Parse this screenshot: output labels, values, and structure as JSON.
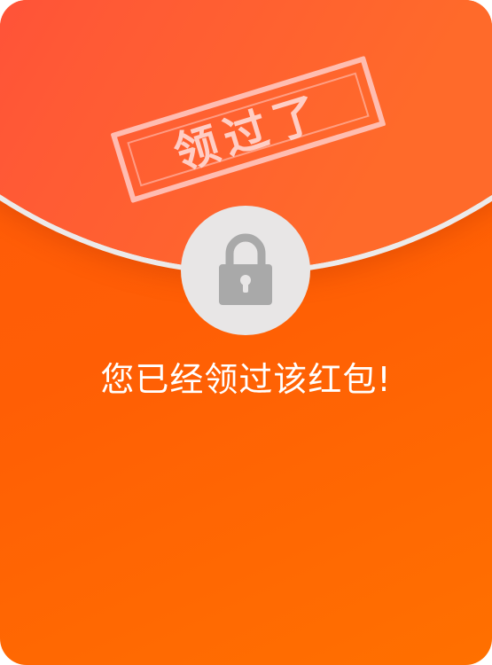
{
  "stamp": {
    "text": "领过了"
  },
  "lock": {
    "icon": "lock-icon"
  },
  "message": "您已经领过该红包!",
  "colors": {
    "flap": "#ff4a3d",
    "body": "#ff6000",
    "circle": "#e8e6e6",
    "lock": "#a9a9a9",
    "text": "#ffffff"
  }
}
